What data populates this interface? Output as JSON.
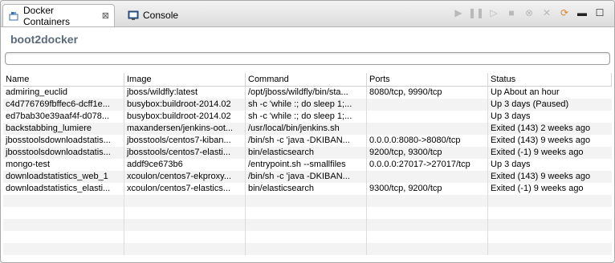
{
  "tabs": [
    {
      "label": "Docker Containers",
      "icon": "docker-containers-icon",
      "active": true
    },
    {
      "label": "Console",
      "icon": "console-icon",
      "active": false
    }
  ],
  "connection": {
    "name": "boot2docker"
  },
  "filter": {
    "value": "",
    "placeholder": ""
  },
  "table": {
    "columns": [
      "Name",
      "Image",
      "Command",
      "Ports",
      "Status"
    ],
    "rows": [
      [
        "admiring_euclid",
        "jboss/wildfly:latest",
        "/opt/jboss/wildfly/bin/sta...",
        "8080/tcp, 9990/tcp",
        "Up About an hour"
      ],
      [
        "c4d776769fbffec6-dcff1e...",
        "busybox:buildroot-2014.02",
        "sh -c 'while :; do sleep 1;...",
        "",
        "Up 3 days (Paused)"
      ],
      [
        "ed7bab30e39aaf4f-d078...",
        "busybox:buildroot-2014.02",
        "sh -c 'while :; do sleep 1;...",
        "",
        "Up 3 days"
      ],
      [
        "backstabbing_lumiere",
        "maxandersen/jenkins-oot...",
        "/usr/local/bin/jenkins.sh",
        "",
        "Exited (143) 2 weeks ago"
      ],
      [
        "jbosstoolsdownloadstatis...",
        "jbosstools/centos7-kiban...",
        "/bin/sh -c 'java -DKIBAN...",
        "0.0.0.0:8080->8080/tcp",
        "Exited (143) 9 weeks ago"
      ],
      [
        "jbosstoolsdownloadstatis...",
        "jbosstools/centos7-elasti...",
        "bin/elasticsearch",
        "9200/tcp, 9300/tcp",
        "Exited (-1) 9 weeks ago"
      ],
      [
        "mongo-test",
        "addf9ce673b6",
        "/entrypoint.sh --smallfiles",
        "0.0.0.0:27017->27017/tcp",
        "Up 3 days"
      ],
      [
        "downloadstatistics_web_1",
        "xcoulon/centos7-ekproxy...",
        "/bin/sh -c 'java -DKIBAN...",
        "",
        "Exited (143) 9 weeks ago"
      ],
      [
        "downloadstatistics_elasti...",
        "xcoulon/centos7-elastics...",
        "bin/elasticsearch",
        "9300/tcp, 9200/tcp",
        "Exited (-1) 9 weeks ago"
      ],
      [
        "",
        "",
        "",
        "",
        ""
      ],
      [
        "",
        "",
        "",
        "",
        ""
      ],
      [
        "",
        "",
        "",
        "",
        ""
      ],
      [
        "",
        "",
        "",
        "",
        ""
      ],
      [
        "",
        "",
        "",
        "",
        ""
      ]
    ]
  },
  "toolbar": {
    "buttons": [
      "start-icon",
      "pause-icon",
      "unpause-icon",
      "stop-icon",
      "kill-icon",
      "remove-icon",
      "refresh-icon",
      "minimize-icon",
      "maximize-icon"
    ]
  },
  "colors": {
    "accent": "#d9832c",
    "header_text": "#5a6a7a"
  }
}
